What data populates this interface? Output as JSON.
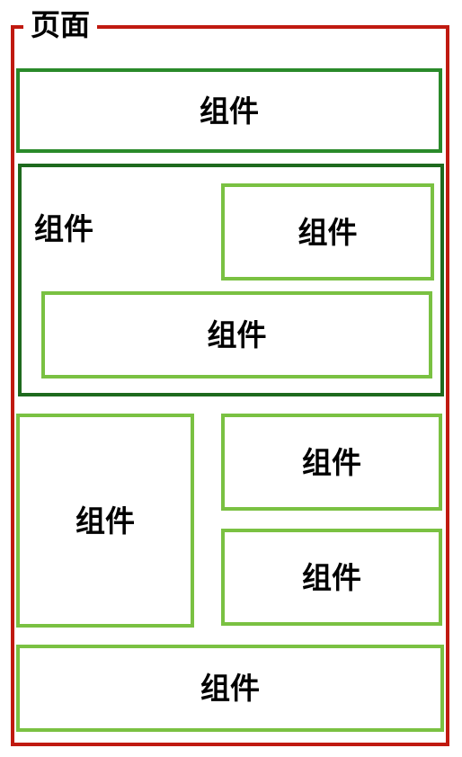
{
  "page": {
    "title": "页面"
  },
  "component_label": "组件",
  "components": [
    {
      "label": "组件"
    },
    {
      "label": "组件"
    },
    {
      "label": "组件"
    },
    {
      "label": "组件"
    },
    {
      "label": "组件"
    },
    {
      "label": "组件"
    },
    {
      "label": "组件"
    },
    {
      "label": "组件"
    }
  ],
  "colors": {
    "page_border": "#c01a10",
    "component_dark": "#2a8a2a",
    "component_container": "#1e6a1e",
    "component_light": "#7ac142"
  }
}
